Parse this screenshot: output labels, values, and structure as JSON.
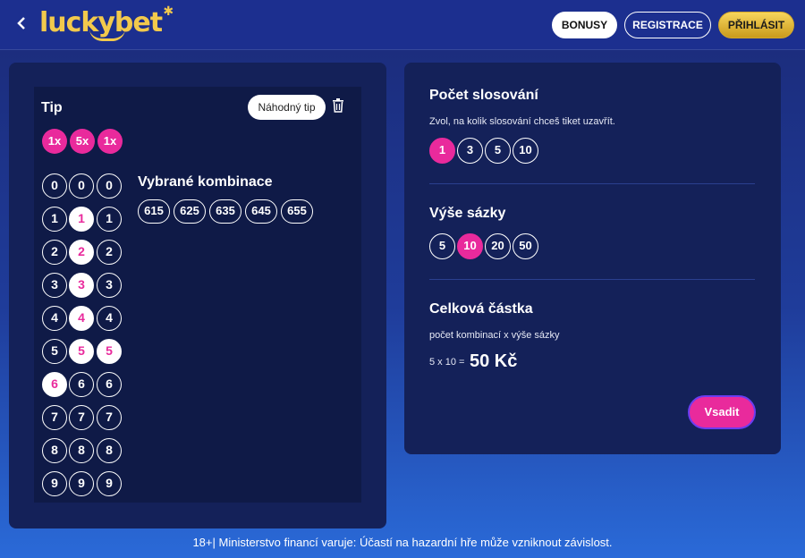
{
  "header": {
    "back_icon": "chevron-left-icon",
    "logo_text": "luckybet",
    "bonusy": "BONUSY",
    "registrace": "REGISTRACE",
    "prihlasit": "PŘIHLÁSIT"
  },
  "tip": {
    "title": "Tip",
    "random_button": "Náhodný tip",
    "delete_icon": "trash-icon",
    "multipliers": [
      "1x",
      "5x",
      "1x"
    ],
    "columns": [
      {
        "digits": [
          "0",
          "1",
          "2",
          "3",
          "4",
          "5",
          "6",
          "7",
          "8",
          "9"
        ],
        "selected": "6"
      },
      {
        "digits": [
          "0",
          "1",
          "2",
          "3",
          "4",
          "5",
          "6",
          "7",
          "8",
          "9"
        ],
        "selected": [
          "1",
          "2",
          "3",
          "4",
          "5"
        ]
      },
      {
        "digits": [
          "0",
          "1",
          "2",
          "3",
          "4",
          "5",
          "6",
          "7",
          "8",
          "9"
        ],
        "selected": "5"
      }
    ],
    "combinations_title": "Vybrané kombinace",
    "combinations": [
      "615",
      "625",
      "635",
      "645",
      "655"
    ]
  },
  "draws": {
    "title": "Počet slosování",
    "subtitle": "Zvol, na kolik slosování chceš tiket uzavřít.",
    "options": [
      "1",
      "3",
      "5",
      "10"
    ],
    "selected": "1"
  },
  "stake": {
    "title": "Výše sázky",
    "options": [
      "5",
      "10",
      "20",
      "50"
    ],
    "selected": "10"
  },
  "total": {
    "title": "Celková částka",
    "subtitle": "počet kombinací x výše sázky",
    "calc": "5 x 10 =",
    "amount": "50 Kč",
    "submit": "Vsadit"
  },
  "footer": "18+| Ministerstvo financí varuje: Účastí na hazardní hře může vzniknout závislost.",
  "colors": {
    "accent": "#e92a9c",
    "gold": "#f2c94c",
    "panel": "#142159"
  }
}
